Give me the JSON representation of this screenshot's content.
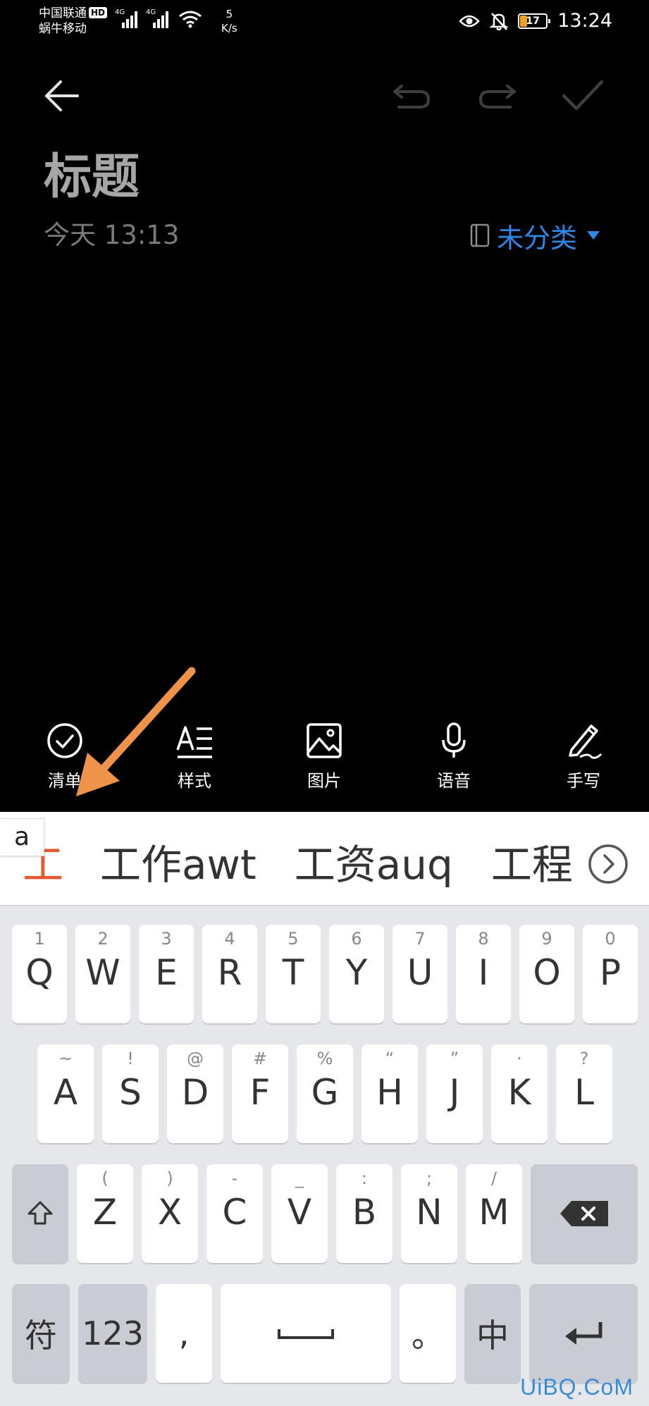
{
  "status_bar": {
    "carrier_1": "中国联通",
    "carrier_hd": "HD",
    "carrier_2": "蜗牛移动",
    "signal_1_label": "4G",
    "signal_2_label": "4G",
    "net_speed_value": "5",
    "net_speed_unit": "K/s",
    "battery_level": "17",
    "time": "13:24"
  },
  "note": {
    "title": "标题",
    "date": "今天 13:13",
    "category": "未分类"
  },
  "format_bar": {
    "items": [
      {
        "label": "清单",
        "icon": "check-circle-icon"
      },
      {
        "label": "样式",
        "icon": "text-style-icon"
      },
      {
        "label": "图片",
        "icon": "image-icon"
      },
      {
        "label": "语音",
        "icon": "microphone-icon"
      },
      {
        "label": "手写",
        "icon": "pen-icon"
      }
    ]
  },
  "ime": {
    "preedit": "a",
    "candidates": [
      "工",
      "工作awt",
      "工资auq",
      "工程"
    ],
    "accent_color": "#e6582d"
  },
  "keyboard": {
    "row1": [
      {
        "hint": "1",
        "key": "Q"
      },
      {
        "hint": "2",
        "key": "W"
      },
      {
        "hint": "3",
        "key": "E"
      },
      {
        "hint": "4",
        "key": "R"
      },
      {
        "hint": "5",
        "key": "T"
      },
      {
        "hint": "6",
        "key": "Y"
      },
      {
        "hint": "7",
        "key": "U"
      },
      {
        "hint": "8",
        "key": "I"
      },
      {
        "hint": "9",
        "key": "O"
      },
      {
        "hint": "0",
        "key": "P"
      }
    ],
    "row2": [
      {
        "hint": "~",
        "key": "A"
      },
      {
        "hint": "!",
        "key": "S"
      },
      {
        "hint": "@",
        "key": "D"
      },
      {
        "hint": "#",
        "key": "F"
      },
      {
        "hint": "%",
        "key": "G"
      },
      {
        "hint": "“",
        "key": "H"
      },
      {
        "hint": "”",
        "key": "J"
      },
      {
        "hint": "·",
        "key": "K"
      },
      {
        "hint": "?",
        "key": "L"
      }
    ],
    "row3": [
      {
        "hint": "(",
        "key": "Z"
      },
      {
        "hint": ")",
        "key": "X"
      },
      {
        "hint": "-",
        "key": "C"
      },
      {
        "hint": "_",
        "key": "V"
      },
      {
        "hint": ":",
        "key": "B"
      },
      {
        "hint": ";",
        "key": "N"
      },
      {
        "hint": "/",
        "key": "M"
      }
    ],
    "symbols_label": "符",
    "numbers_label": "123",
    "comma_label": ",",
    "period_label": "。",
    "lang_label": "中"
  },
  "watermark": "UiBQ.CoM"
}
